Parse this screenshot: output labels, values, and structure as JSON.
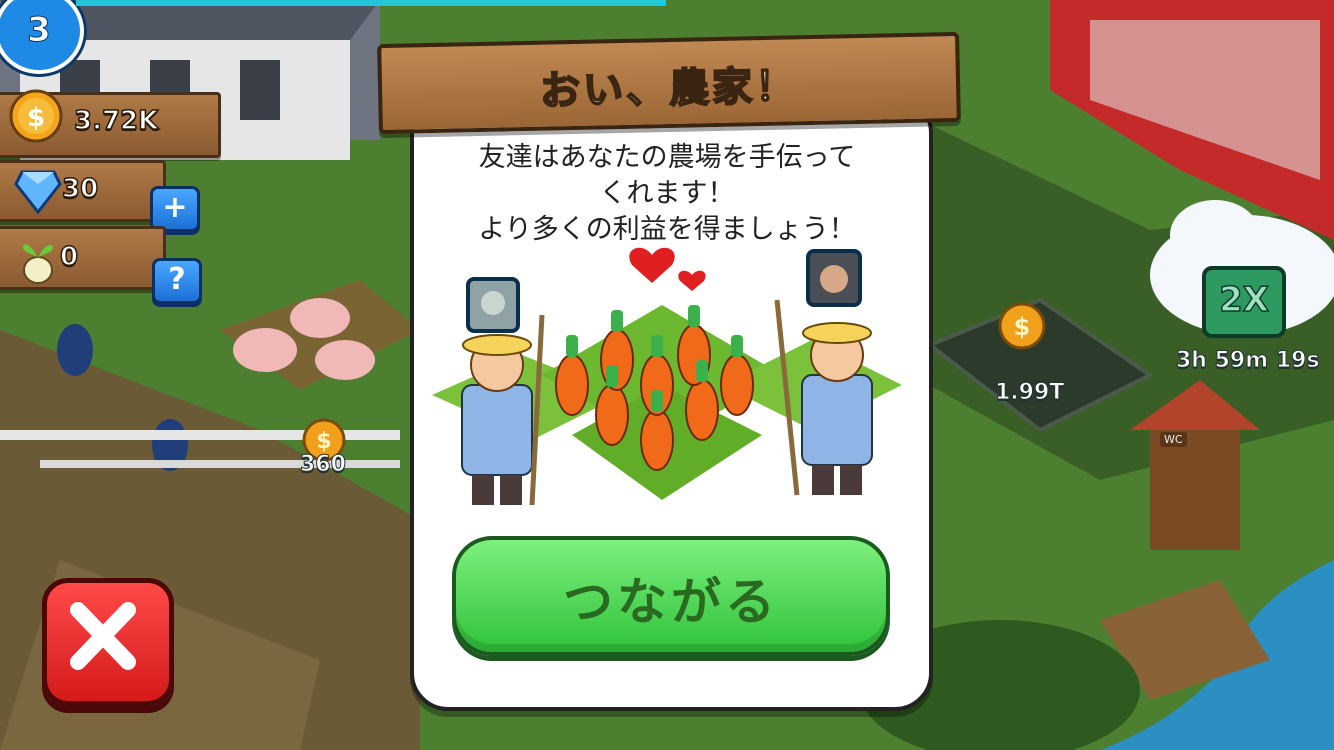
{
  "hud": {
    "level": "3",
    "coins": "3.72K",
    "gems": "30",
    "seeds": "0",
    "add_button_label": "+",
    "help_button_label": "?"
  },
  "map": {
    "coin_value_left": "360",
    "coin_value_right": "1.99T",
    "multiplier_label": "2X",
    "multiplier_timer": "3h 59m 19s",
    "outhouse_sign": "WC"
  },
  "dialog": {
    "title": "おい、農家！",
    "message_lines": [
      "友達はあなたの農場を手伝って",
      "くれます！",
      "より多くの利益を得ましょう！"
    ],
    "connect_label": "つながる"
  },
  "colors": {
    "accent_green": "#2fc23a",
    "close_red": "#d51a1a",
    "plank_brown": "#9b6636",
    "level_blue": "#1e8ae6"
  },
  "icons": {
    "coin": "dollar-coin-icon",
    "gem": "diamond-icon",
    "seed": "seed-sprout-icon",
    "close": "x-icon"
  }
}
